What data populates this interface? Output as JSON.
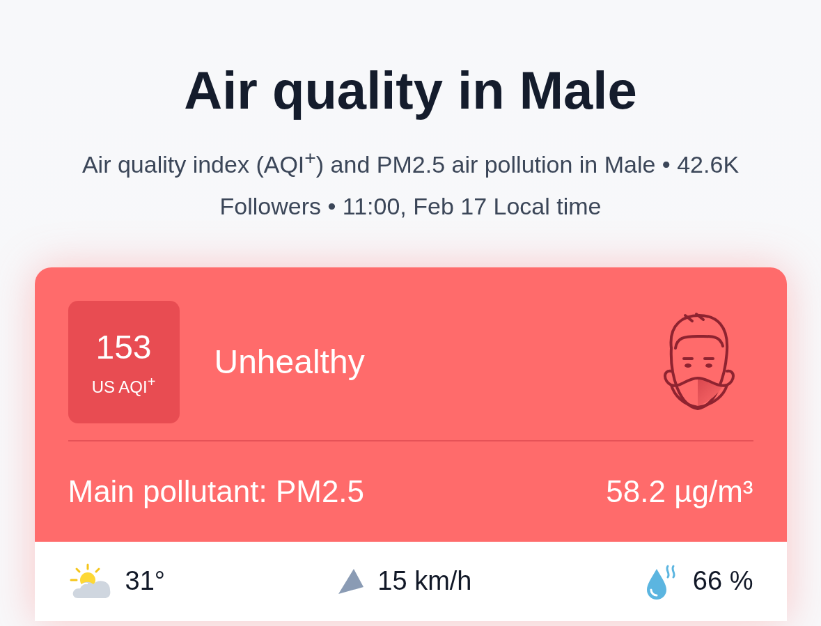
{
  "title": "Air quality in Male",
  "subtitle": "Air quality index (AQI$^{+}$) and PM2.5 air pollution in Male • 42.6K Followers • 11:00, Feb 17 Local time",
  "aqi": {
    "value": "153",
    "unit": "US AQI$^{+}$",
    "status": "Unhealthy"
  },
  "pollutant": {
    "label": "Main pollutant: PM2.5",
    "concentration": "58.2 µg/m³"
  },
  "weather": [
    {
      "kind": "temperature",
      "value": "31°"
    },
    {
      "kind": "wind",
      "value": "15 km/h"
    },
    {
      "kind": "humidity",
      "value": "66 %"
    }
  ]
}
